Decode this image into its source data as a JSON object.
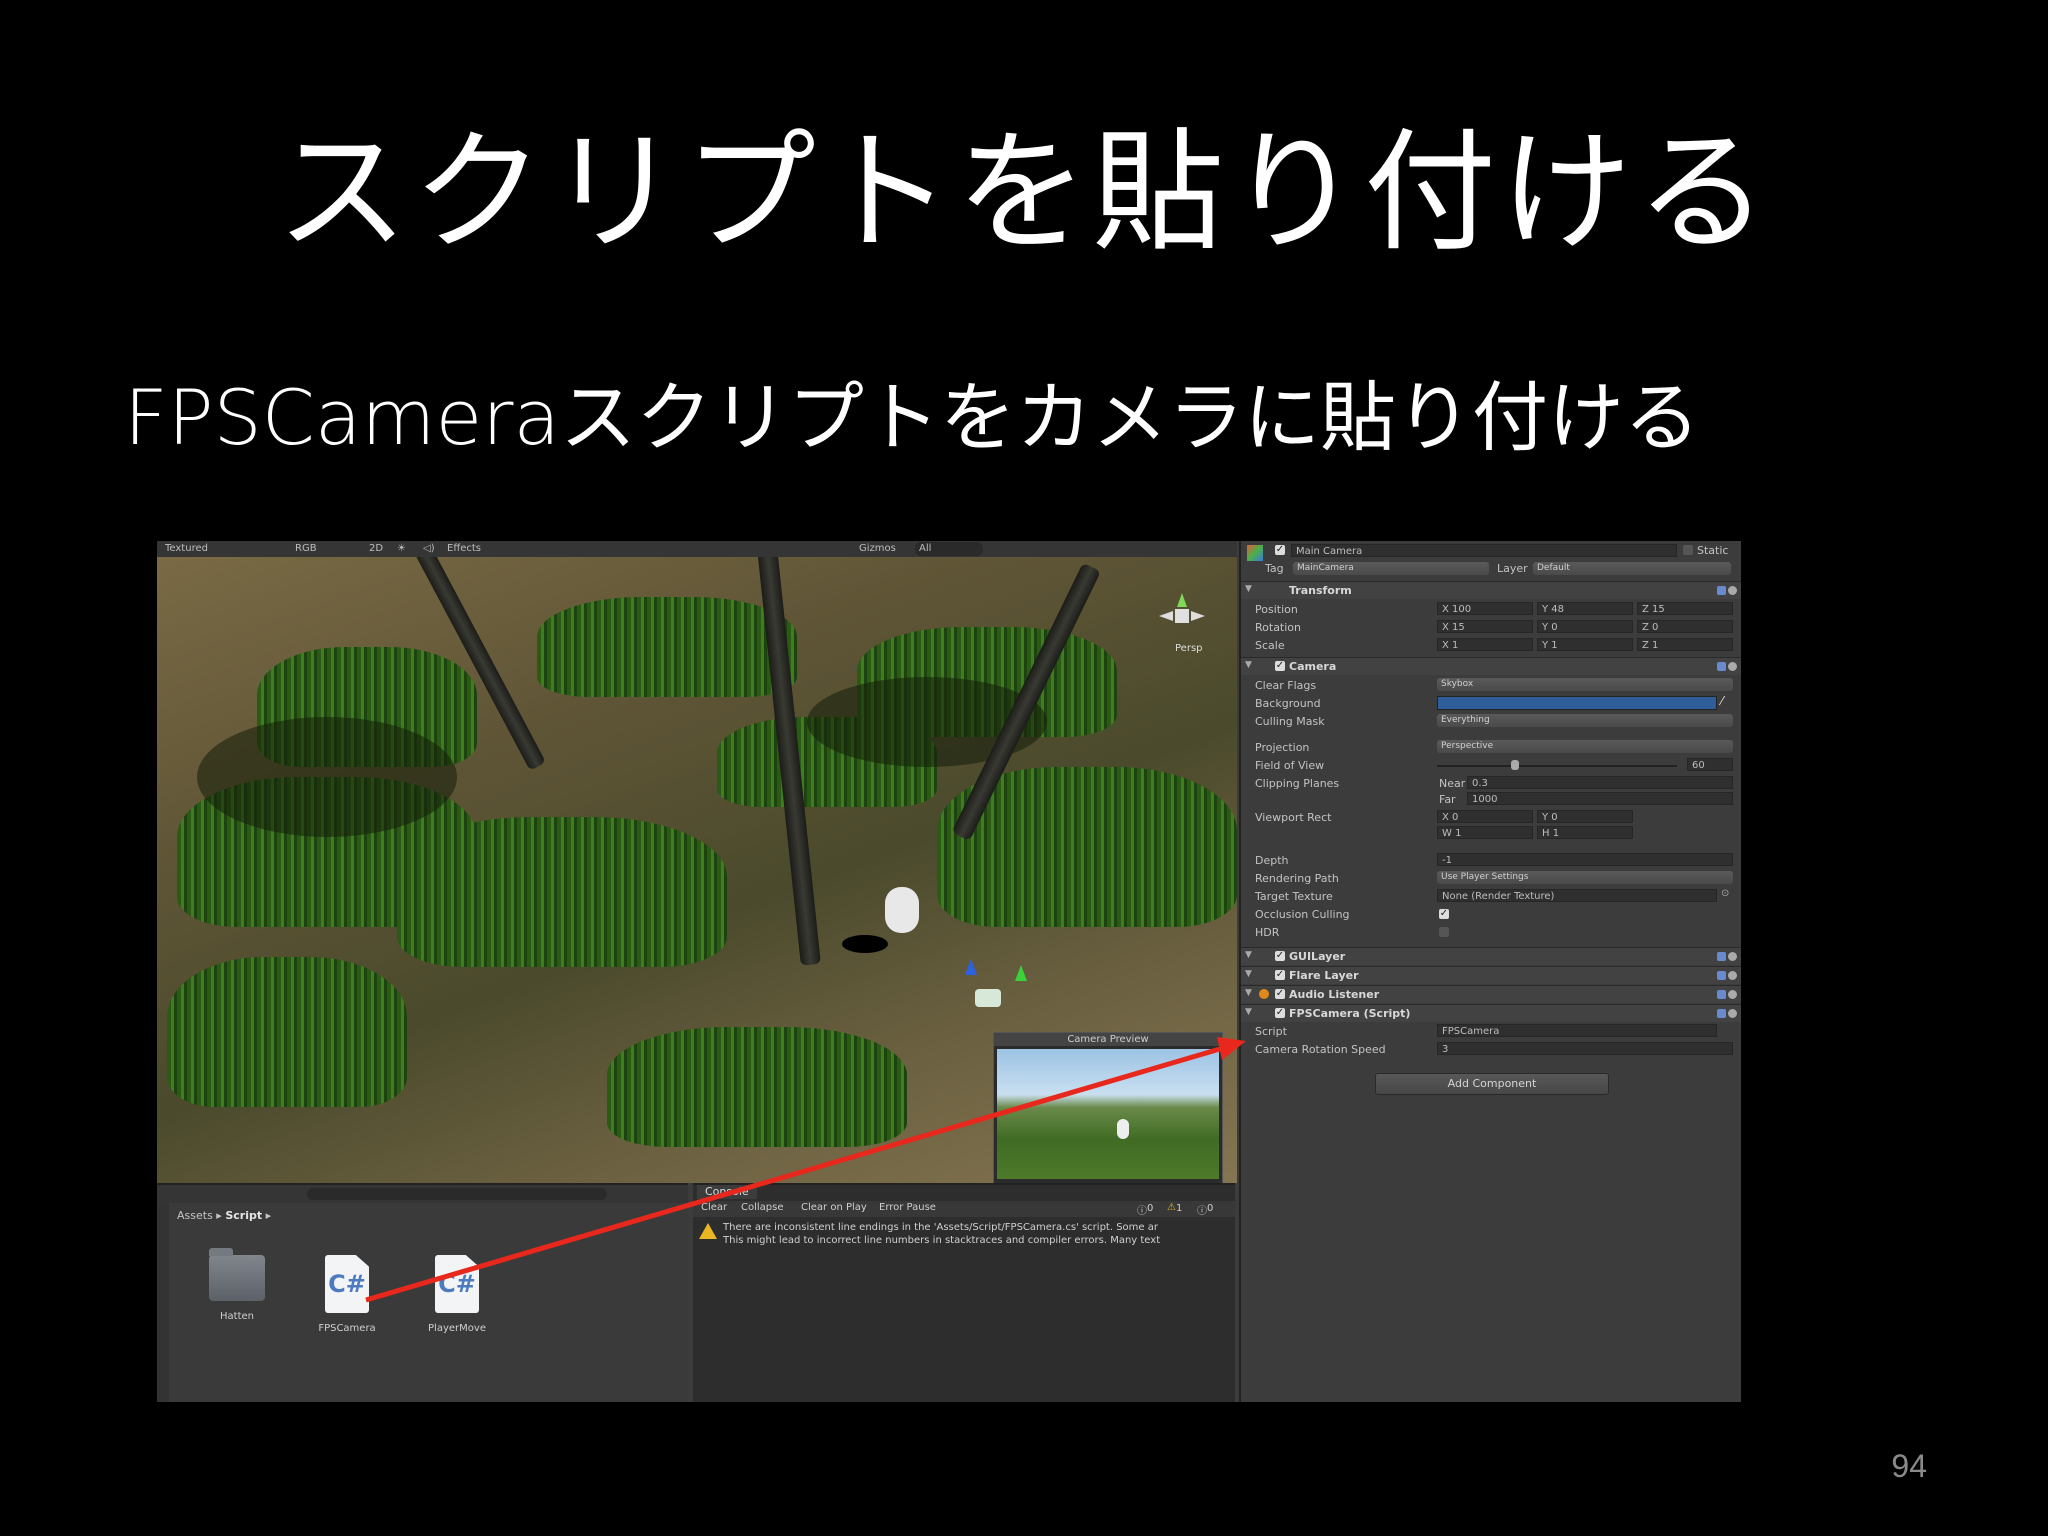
{
  "slide": {
    "title": "スクリプトを貼り付ける",
    "subtitle": "FPSCameraスクリプトをカメラに貼り付ける",
    "page_number": "94"
  },
  "scene_toolbar": {
    "shading": "Textured",
    "render_mode": "RGB",
    "mode_2d": "2D",
    "effects": "Effects",
    "gizmos": "Gizmos",
    "search": "All",
    "persp_label": "Persp"
  },
  "camera_preview": {
    "title": "Camera Preview"
  },
  "project": {
    "breadcrumb_root": "Assets",
    "breadcrumb_folder": "Script",
    "assets": [
      "Hatten",
      "FPSCamera",
      "PlayerMove"
    ]
  },
  "console": {
    "tab": "Console",
    "buttons": [
      "Clear",
      "Collapse",
      "Clear on Play",
      "Error Pause"
    ],
    "counts": [
      "0",
      "1",
      "0"
    ],
    "message_line1": "There are inconsistent line endings in the 'Assets/Script/FPSCamera.cs' script. Some ar",
    "message_line2": "This might lead to incorrect line numbers in stacktraces and compiler errors. Many text"
  },
  "inspector": {
    "object_name": "Main Camera",
    "static_label": "Static",
    "tag_label": "Tag",
    "tag_value": "MainCamera",
    "layer_label": "Layer",
    "layer_value": "Default",
    "transform": {
      "title": "Transform",
      "position_label": "Position",
      "pos_x": "100",
      "pos_y": "48",
      "pos_z": "15",
      "rotation_label": "Rotation",
      "rot_x": "15",
      "rot_y": "0",
      "rot_z": "0",
      "scale_label": "Scale",
      "scale_x": "1",
      "scale_y": "1",
      "scale_z": "1"
    },
    "camera": {
      "title": "Camera",
      "clear_flags_label": "Clear Flags",
      "clear_flags": "Skybox",
      "background_label": "Background",
      "culling_mask_label": "Culling Mask",
      "culling_mask": "Everything",
      "projection_label": "Projection",
      "projection": "Perspective",
      "fov_label": "Field of View",
      "fov": "60",
      "clipping_label": "Clipping Planes",
      "near_label": "Near",
      "near": "0.3",
      "far_label": "Far",
      "far": "1000",
      "viewport_label": "Viewport Rect",
      "vx": "0",
      "vy": "0",
      "vw": "1",
      "vh": "1",
      "depth_label": "Depth",
      "depth": "-1",
      "rendering_path_label": "Rendering Path",
      "rendering_path": "Use Player Settings",
      "target_texture_label": "Target Texture",
      "target_texture": "None (Render Texture)",
      "occlusion_label": "Occlusion Culling",
      "hdr_label": "HDR"
    },
    "gui_layer": "GUILayer",
    "flare_layer": "Flare Layer",
    "audio_listener": "Audio Listener",
    "fps_script": {
      "title": "FPSCamera (Script)",
      "script_label": "Script",
      "script_value": "FPSCamera",
      "rot_speed_label": "Camera Rotation Speed",
      "rot_speed": "3"
    },
    "add_component": "Add Component"
  },
  "colors": {
    "background_swatch": "#2f5d9a",
    "arrow": "#e8281c"
  }
}
